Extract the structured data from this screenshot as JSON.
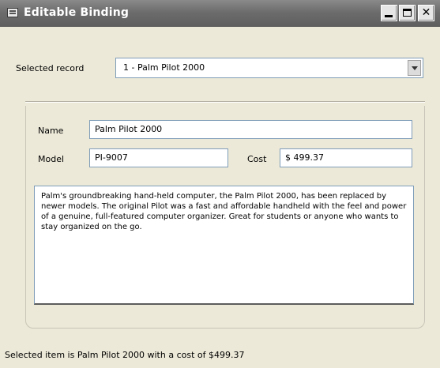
{
  "window": {
    "title": "Editable Binding",
    "buttons": [
      "minimize",
      "maximize",
      "close"
    ]
  },
  "selector": {
    "label": "Selected record",
    "value": "1 - Palm Pilot 2000"
  },
  "form": {
    "name_label": "Name",
    "name_value": "Palm Pilot 2000",
    "model_label": "Model",
    "model_value": "PI-9007",
    "cost_label": "Cost",
    "cost_value": "$ 499.37",
    "description": "Palm's groundbreaking hand-held computer, the Palm Pilot 2000, has been replaced by newer models. The original Pilot was a fast and affordable handheld with the feel and power of a genuine, full-featured computer organizer. Great for students or anyone who wants to stay organized on the go."
  },
  "status": {
    "text": "Selected item is Palm Pilot 2000 with a cost of $499.37"
  }
}
